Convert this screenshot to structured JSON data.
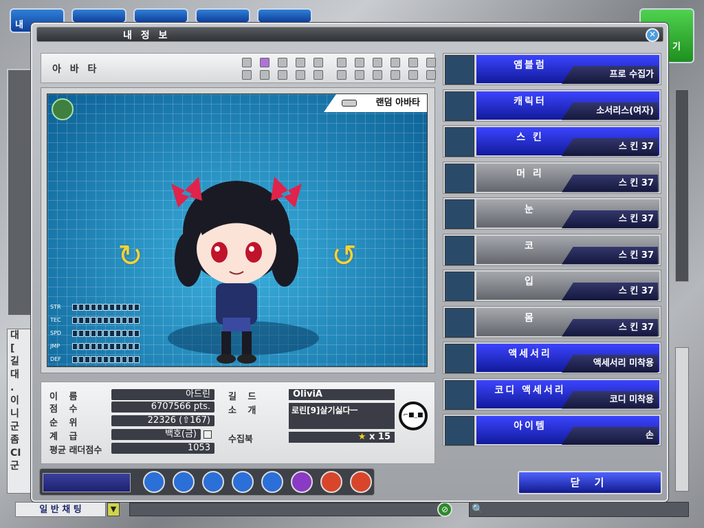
{
  "topbar": {
    "btn1_label": "내",
    "btn_exit_label": "기"
  },
  "window": {
    "title": "내 정 보"
  },
  "avatar_header": {
    "title": "아 바 타",
    "slots_top": [
      false,
      true,
      false,
      false,
      false,
      false,
      false,
      false,
      false,
      false,
      false
    ],
    "slots_bottom_count": 11
  },
  "stage": {
    "random_avatar": "랜덤 아바타",
    "stats": [
      {
        "name": "STR",
        "filled": 0
      },
      {
        "name": "TEC",
        "filled": 0
      },
      {
        "name": "SPD",
        "filled": 0
      },
      {
        "name": "JMP",
        "filled": 0
      },
      {
        "name": "DEF",
        "filled": 0
      }
    ]
  },
  "profile": {
    "name_label": "이 름",
    "name": "아드린",
    "score_label": "점 수",
    "score": "6707566 pts.",
    "rank_label": "순 위",
    "rank": "22326 (⇧167)",
    "grade_label": "계 급",
    "grade": "백호(금)",
    "ladder_label": "평균 래더점수",
    "ladder": "1053",
    "guild_label": "길 드",
    "guild": "OliviA",
    "intro_label": "소 개",
    "intro": "로린[9]살기싫다ㅡ",
    "collection_label": "수집북",
    "collection_star": "★",
    "collection": "x 15"
  },
  "equipment": [
    {
      "label": "앰블럼",
      "value": "프로 수집가",
      "style": "blue",
      "icon": "emblem-icon"
    },
    {
      "label": "캐릭터",
      "value": "소서리스(여자)",
      "style": "blue",
      "icon": "character-portrait-icon"
    },
    {
      "label": "스 킨",
      "value": "스 킨 37",
      "style": "blue",
      "icon": "skin-icon"
    },
    {
      "label": "머 리",
      "value": "스 킨 37",
      "style": "grey",
      "icon": "hair-icon"
    },
    {
      "label": "눈",
      "value": "스 킨 37",
      "style": "grey",
      "icon": "eyes-icon"
    },
    {
      "label": "코",
      "value": "스 킨 37",
      "style": "grey",
      "icon": "nose-icon"
    },
    {
      "label": "입",
      "value": "스 킨 37",
      "style": "grey",
      "icon": "mouth-icon"
    },
    {
      "label": "몸",
      "value": "스 킨 37",
      "style": "grey",
      "icon": "body-icon"
    },
    {
      "label": "액세서리",
      "value": "액세서리 미착용",
      "style": "blue",
      "icon": "accessory-icon"
    },
    {
      "label": "코디 액세서리",
      "value": "코디 미착용",
      "style": "blue",
      "icon": "coordi-accessory-icon"
    },
    {
      "label": "아이템",
      "value": "손",
      "style": "blue",
      "icon": "hand-icon"
    }
  ],
  "close_button": "닫 기",
  "chat": {
    "mode": "일 반 채 팅",
    "side_chars": [
      "대",
      "[",
      "길",
      "대",
      ".",
      "이",
      "니",
      "군",
      "좀",
      "CI",
      "군"
    ]
  },
  "bottom_icons": [
    {
      "name": "hexagon-icon",
      "color": "#2b6fd8"
    },
    {
      "name": "speech-icon",
      "color": "#2b6fd8"
    },
    {
      "name": "box-icon",
      "color": "#2b6fd8"
    },
    {
      "name": "book-icon",
      "color": "#2b6fd8"
    },
    {
      "name": "star-icon",
      "color": "#2b6fd8"
    },
    {
      "name": "bell-icon",
      "color": "#8a3ac4"
    },
    {
      "name": "chart-icon",
      "color": "#d8452b"
    },
    {
      "name": "card-icon",
      "color": "#d8452b"
    }
  ]
}
